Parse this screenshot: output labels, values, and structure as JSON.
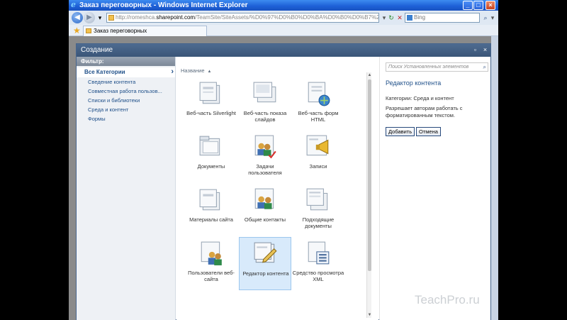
{
  "window": {
    "title": "Заказ переговорных - Windows Internet Explorer"
  },
  "address": {
    "url_prefix": "http://romeshca.",
    "url_domain": "sharepoint.com",
    "url_suffix": "/TeamSite/SiteAssets/%D0%97%D0%B0%D0%BA%D0%B0%D0%B7%20%D0%BF"
  },
  "search": {
    "placeholder": "Bing"
  },
  "tab": {
    "label": "Заказ переговорных"
  },
  "dialog": {
    "title": "Создание"
  },
  "filter": {
    "heading": "Фильтр:",
    "selected": "Все Категории",
    "categories": [
      "Сведение контента",
      "Совместная работа пользов...",
      "Списки и библиотеки",
      "Среда и контент",
      "Формы"
    ]
  },
  "gallery": {
    "sort_label": "Название",
    "items": [
      {
        "label": "Веб-часть Silverlight",
        "icon": "silverlight-webpart-icon"
      },
      {
        "label": "Веб-часть показа слайдов",
        "icon": "slideshow-webpart-icon"
      },
      {
        "label": "Веб-часть форм HTML",
        "icon": "html-form-webpart-icon"
      },
      {
        "label": "Документы",
        "icon": "documents-library-icon"
      },
      {
        "label": "Задачи пользователя",
        "icon": "user-tasks-icon"
      },
      {
        "label": "Записи",
        "icon": "announcements-icon"
      },
      {
        "label": "Материалы сайта",
        "icon": "site-content-icon"
      },
      {
        "label": "Общие контакты",
        "icon": "shared-contacts-icon"
      },
      {
        "label": "Подходящие документы",
        "icon": "relevant-documents-icon"
      },
      {
        "label": "Пользователи веб-сайта",
        "icon": "site-users-icon"
      },
      {
        "label": "Редактор контента",
        "icon": "content-editor-icon",
        "selected": true
      },
      {
        "label": "Средство просмотра XML",
        "icon": "xml-viewer-icon"
      }
    ]
  },
  "detail": {
    "search_placeholder": "Поиск Установленных элементов",
    "title": "Редактор контента",
    "category": "Категории: Среда и контент",
    "description": "Разрешает авторам работать с форматированным текстом.",
    "add_button": "Добавить",
    "cancel_button": "Отмена"
  },
  "watermark": "TeachPro.ru"
}
